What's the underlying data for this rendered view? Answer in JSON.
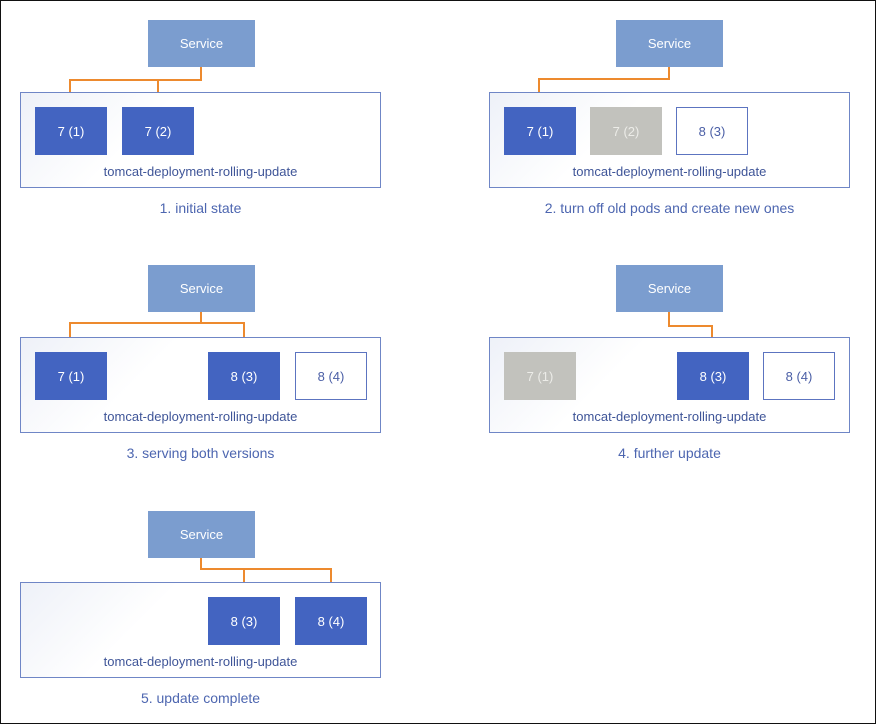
{
  "colors": {
    "service": "#7b9dcf",
    "pod_active": "#4364c1",
    "pod_terminating": "#c2c2bd",
    "pod_creating_border": "#5c74c0",
    "arrow": "#ed8a2e",
    "caption_text": "#4d66b0"
  },
  "panels": [
    {
      "service_label": "Service",
      "deployment_label": "tomcat-deployment-rolling-update",
      "caption": "1. initial state",
      "pods": [
        {
          "label": "7 (1)",
          "state": "active",
          "routed": true
        },
        {
          "label": "7 (2)",
          "state": "active",
          "routed": true
        }
      ]
    },
    {
      "service_label": "Service",
      "deployment_label": "tomcat-deployment-rolling-update",
      "caption": "2. turn off old pods and create new ones",
      "pods": [
        {
          "label": "7 (1)",
          "state": "active",
          "routed": true
        },
        {
          "label": "7 (2)",
          "state": "terminating",
          "routed": false
        },
        {
          "label": "8 (3)",
          "state": "creating",
          "routed": false
        }
      ]
    },
    {
      "service_label": "Service",
      "deployment_label": "tomcat-deployment-rolling-update",
      "caption": "3. serving both versions",
      "pods": [
        {
          "label": "7 (1)",
          "state": "active",
          "routed": true
        },
        {
          "label": "8 (3)",
          "state": "active",
          "routed": true
        },
        {
          "label": "8 (4)",
          "state": "creating",
          "routed": false
        }
      ]
    },
    {
      "service_label": "Service",
      "deployment_label": "tomcat-deployment-rolling-update",
      "caption": "4. further update",
      "pods": [
        {
          "label": "7 (1)",
          "state": "terminating",
          "routed": false
        },
        {
          "label": "8 (3)",
          "state": "active",
          "routed": true
        },
        {
          "label": "8 (4)",
          "state": "creating",
          "routed": false
        }
      ]
    },
    {
      "service_label": "Service",
      "deployment_label": "tomcat-deployment-rolling-update",
      "caption": "5. update complete",
      "pods": [
        {
          "label": "8 (3)",
          "state": "active",
          "routed": true
        },
        {
          "label": "8 (4)",
          "state": "active",
          "routed": true
        }
      ]
    }
  ]
}
